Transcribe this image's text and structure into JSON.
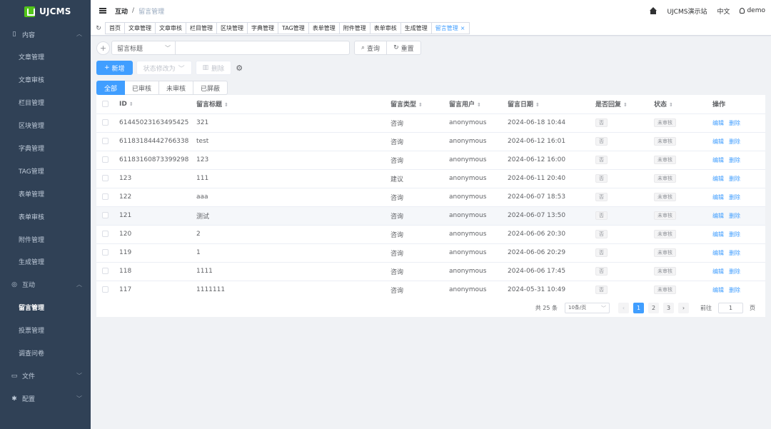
{
  "brand": {
    "name": "UJCMS",
    "accent": "#409eff",
    "sidebar_bg": "#304156",
    "logo_color": "#52c41a"
  },
  "sidebar": {
    "groups": [
      {
        "label": "内容",
        "icon": "document-icon",
        "items": [
          "文章管理",
          "文章审核",
          "栏目管理",
          "区块管理",
          "字典管理",
          "TAG管理",
          "表单管理",
          "表单审核",
          "附件管理",
          "生成管理"
        ]
      },
      {
        "label": "互动",
        "icon": "chat-icon",
        "items": [
          "留言管理",
          "投票管理",
          "调查问卷"
        ],
        "active_item": "留言管理"
      },
      {
        "label": "文件",
        "icon": "folder-icon",
        "items": []
      },
      {
        "label": "配置",
        "icon": "gear-icon",
        "items": []
      }
    ]
  },
  "header": {
    "breadcrumb": [
      "互动",
      "留言管理"
    ],
    "site": "UJCMS演示站",
    "language": "中文",
    "user": "demo"
  },
  "tabs": [
    "首页",
    "文章管理",
    "文章审核",
    "栏目管理",
    "区块管理",
    "字典管理",
    "TAG管理",
    "表单管理",
    "附件管理",
    "表单审核",
    "生成管理",
    "留言管理"
  ],
  "active_tab": "留言管理",
  "search": {
    "field": "留言标题",
    "query_label": "查询",
    "reset_label": "重置"
  },
  "actions": {
    "add_label": "新增",
    "status_change_label": "状态修改为",
    "delete_label": "删除"
  },
  "status_tabs": [
    "全部",
    "已审核",
    "未审核",
    "已屏蔽"
  ],
  "active_status": "全部",
  "table": {
    "columns": [
      "ID",
      "留言标题",
      "留言类型",
      "留言用户",
      "留言日期",
      "是否回复",
      "状态",
      "操作"
    ],
    "edit_label": "编辑",
    "delete_label": "删除",
    "rows": [
      {
        "id": "61445023163495425",
        "title": "321",
        "type": "咨询",
        "user": "anonymous",
        "date": "2024-06-18 10:44",
        "replied": "否",
        "status": "未审核"
      },
      {
        "id": "61183184442766338",
        "title": "test",
        "type": "咨询",
        "user": "anonymous",
        "date": "2024-06-12 16:01",
        "replied": "否",
        "status": "未审核"
      },
      {
        "id": "61183160873399298",
        "title": "123",
        "type": "咨询",
        "user": "anonymous",
        "date": "2024-06-12 16:00",
        "replied": "否",
        "status": "未审核"
      },
      {
        "id": "123",
        "title": "111",
        "type": "建议",
        "user": "anonymous",
        "date": "2024-06-11 20:40",
        "replied": "否",
        "status": "未审核"
      },
      {
        "id": "122",
        "title": "aaa",
        "type": "咨询",
        "user": "anonymous",
        "date": "2024-06-07 18:53",
        "replied": "否",
        "status": "未审核"
      },
      {
        "id": "121",
        "title": "测试",
        "type": "咨询",
        "user": "anonymous",
        "date": "2024-06-07 13:50",
        "replied": "否",
        "status": "未审核"
      },
      {
        "id": "120",
        "title": "2",
        "type": "咨询",
        "user": "anonymous",
        "date": "2024-06-06 20:30",
        "replied": "否",
        "status": "未审核"
      },
      {
        "id": "119",
        "title": "1",
        "type": "咨询",
        "user": "anonymous",
        "date": "2024-06-06 20:29",
        "replied": "否",
        "status": "未审核"
      },
      {
        "id": "118",
        "title": "1111",
        "type": "咨询",
        "user": "anonymous",
        "date": "2024-06-06 17:45",
        "replied": "否",
        "status": "未审核"
      },
      {
        "id": "117",
        "title": "1111111",
        "type": "咨询",
        "user": "anonymous",
        "date": "2024-05-31 10:49",
        "replied": "否",
        "status": "未审核"
      }
    ]
  },
  "pagination": {
    "total_text": "共 25 条",
    "page_size": "10条/页",
    "pages": [
      "1",
      "2",
      "3"
    ],
    "current": "1",
    "goto_label": "前往",
    "goto_value": "1",
    "page_suffix": "页"
  }
}
